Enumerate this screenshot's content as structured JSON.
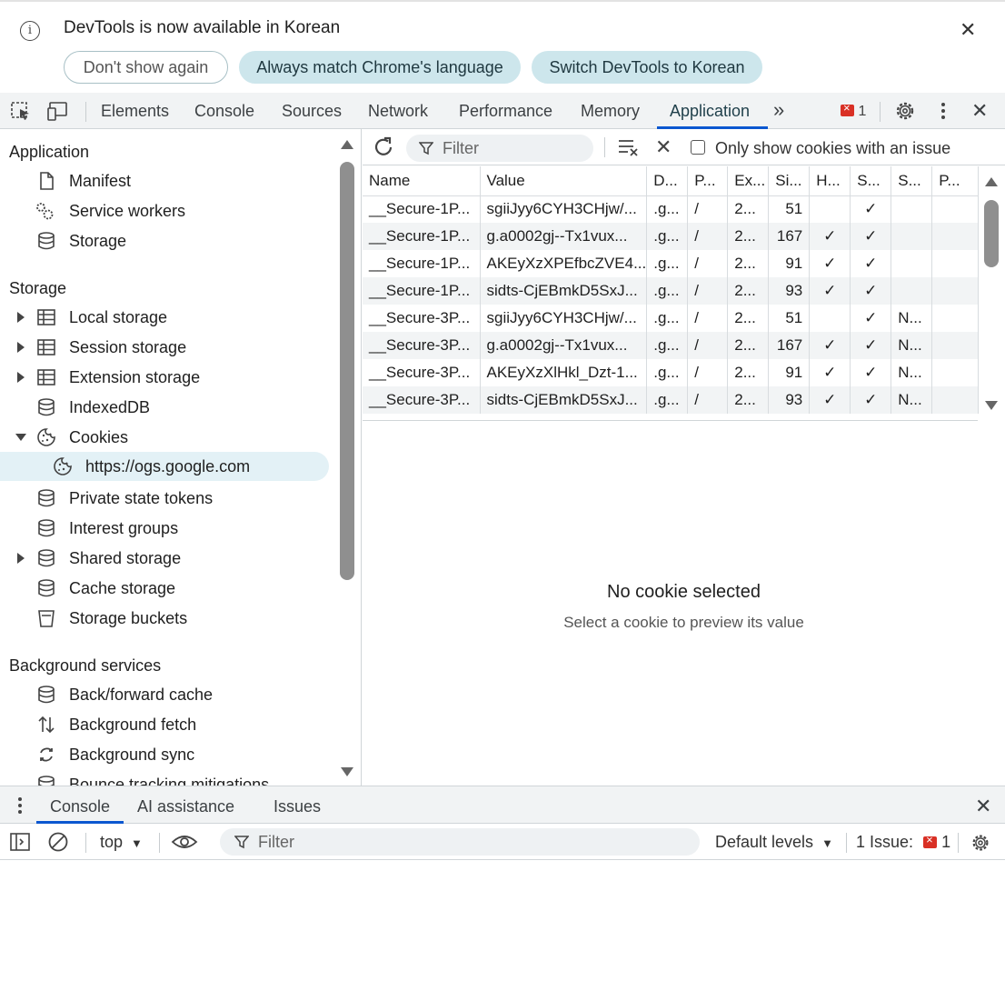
{
  "infobar": {
    "message": "DevTools is now available in Korean",
    "dont_show": "Don't show again",
    "always_match": "Always match Chrome's language",
    "switch_lang": "Switch DevTools to Korean"
  },
  "toolbar": {
    "tabs": [
      "Elements",
      "Console",
      "Sources",
      "Network",
      "Performance",
      "Memory",
      "Application"
    ],
    "active_tab": "Application",
    "issue_count": "1"
  },
  "sidebar": {
    "section_application": "Application",
    "application_items": [
      "Manifest",
      "Service workers",
      "Storage"
    ],
    "section_storage": "Storage",
    "storage_items": [
      "Local storage",
      "Session storage",
      "Extension storage",
      "IndexedDB",
      "Cookies",
      "https://ogs.google.com",
      "Private state tokens",
      "Interest groups",
      "Shared storage",
      "Cache storage",
      "Storage buckets"
    ],
    "section_background": "Background services",
    "background_items": [
      "Back/forward cache",
      "Background fetch",
      "Background sync",
      "Bounce tracking mitigations"
    ]
  },
  "cookies": {
    "filter_placeholder": "Filter",
    "only_issues_label": "Only show cookies with an issue",
    "columns": [
      "Name",
      "Value",
      "D...",
      "P...",
      "Ex...",
      "Si...",
      "H...",
      "S...",
      "S...",
      "P..."
    ],
    "rows": [
      [
        "__Secure-1P...",
        "sgiiJyy6CYH3CHjw/...",
        ".g...",
        "/",
        "2...",
        "51",
        "",
        "✓",
        "",
        ""
      ],
      [
        "__Secure-1P...",
        "g.a0002gj--Tx1vux...",
        ".g...",
        "/",
        "2...",
        "167",
        "✓",
        "✓",
        "",
        ""
      ],
      [
        "__Secure-1P...",
        "AKEyXzXPEfbcZVE4...",
        ".g...",
        "/",
        "2...",
        "91",
        "✓",
        "✓",
        "",
        ""
      ],
      [
        "__Secure-1P...",
        "sidts-CjEBmkD5SxJ...",
        ".g...",
        "/",
        "2...",
        "93",
        "✓",
        "✓",
        "",
        ""
      ],
      [
        "__Secure-3P...",
        "sgiiJyy6CYH3CHjw/...",
        ".g...",
        "/",
        "2...",
        "51",
        "",
        "✓",
        "N...",
        ""
      ],
      [
        "__Secure-3P...",
        "g.a0002gj--Tx1vux...",
        ".g...",
        "/",
        "2...",
        "167",
        "✓",
        "✓",
        "N...",
        ""
      ],
      [
        "__Secure-3P...",
        "AKEyXzXlHkl_Dzt-1...",
        ".g...",
        "/",
        "2...",
        "91",
        "✓",
        "✓",
        "N...",
        ""
      ],
      [
        "__Secure-3P...",
        "sidts-CjEBmkD5SxJ...",
        ".g...",
        "/",
        "2...",
        "93",
        "✓",
        "✓",
        "N...",
        ""
      ]
    ],
    "empty_title": "No cookie selected",
    "empty_subtitle": "Select a cookie to preview its value"
  },
  "drawer": {
    "tabs": [
      "Console",
      "AI assistance",
      "Issues"
    ],
    "active_tab": "Console",
    "context": "top",
    "filter_placeholder": "Filter",
    "levels": "Default levels",
    "issues_label": "1 Issue:",
    "issues_count": "1"
  },
  "colors": {
    "accent": "#0b57d0",
    "pill_fill": "#cde6ec",
    "selected_row": "#e3f1f6",
    "error_red": "#d93025"
  }
}
